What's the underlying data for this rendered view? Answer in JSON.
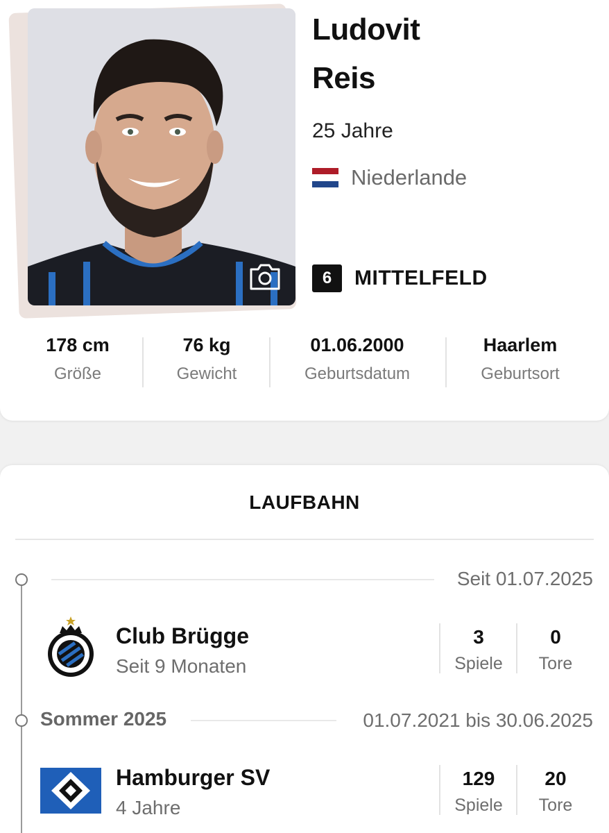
{
  "player": {
    "first_name": "Ludovit",
    "last_name": "Reis",
    "age": "25 Jahre",
    "nationality": "Niederlande",
    "flag_colors": [
      "#ae1c28",
      "#ffffff",
      "#21468b"
    ],
    "shirt_number": "6",
    "position": "MITTELFELD"
  },
  "stats": [
    {
      "value": "178 cm",
      "label": "Größe"
    },
    {
      "value": "76 kg",
      "label": "Gewicht"
    },
    {
      "value": "01.06.2000",
      "label": "Geburtsdatum"
    },
    {
      "value": "Haarlem",
      "label": "Geburtsort"
    }
  ],
  "career": {
    "title": "LAUFBAHN",
    "entries": [
      {
        "period": "Seit 01.07.2025",
        "club": "Club Brügge",
        "duration": "Seit 9 Monaten",
        "games_value": "3",
        "games_label": "Spiele",
        "goals_value": "0",
        "goals_label": "Tore",
        "logo": "club-bruegge-crest"
      },
      {
        "season": "Sommer 2025",
        "period": "01.07.2021 bis 30.06.2025",
        "club": "Hamburger SV",
        "duration": "4 Jahre",
        "games_value": "129",
        "games_label": "Spiele",
        "goals_value": "20",
        "goals_label": "Tore",
        "logo": "hsv-diamond"
      }
    ]
  },
  "icons": {
    "camera": "camera-icon"
  }
}
